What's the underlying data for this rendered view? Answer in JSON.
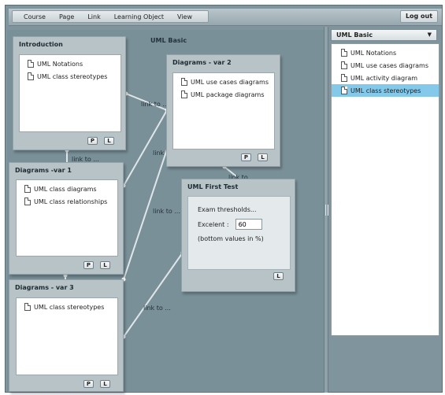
{
  "menu": {
    "items": [
      "Course",
      "Page",
      "Link",
      "Learning Object",
      "View"
    ],
    "logout": "Log out"
  },
  "canvas": {
    "title": "UML Basic",
    "link_label": "link to ...",
    "nodes": {
      "introduction": {
        "title": "Introduction",
        "items": [
          "UML Notations",
          "UML class stereotypes"
        ],
        "buttons": [
          "P",
          "L"
        ]
      },
      "diagrams_var2": {
        "title": "Diagrams - var 2",
        "items": [
          "UML use cases diagrams",
          "UML package diagrams"
        ],
        "buttons": [
          "P",
          "L"
        ]
      },
      "diagrams_var1": {
        "title": "Diagrams -var 1",
        "items": [
          "UML class diagrams",
          "UML class relationships"
        ],
        "buttons": [
          "P",
          "L"
        ]
      },
      "diagrams_var3": {
        "title": "Diagrams - var 3",
        "items": [
          "UML class stereotypes"
        ],
        "buttons": [
          "P",
          "L"
        ]
      },
      "first_test": {
        "title": "UML First Test",
        "thresholds_label": "Exam thresholds...",
        "excellent_label": "Excelent :",
        "excellent_value": "60",
        "note": "(bottom values in %)",
        "buttons": [
          "L"
        ]
      }
    }
  },
  "panel": {
    "selected": "UML Basic",
    "items": [
      "UML Notations",
      "UML use cases diagrams",
      "UML activity diagram",
      "UML class stereotypes"
    ],
    "selected_index": 3
  },
  "colors": {
    "background": "#7a9099",
    "node": "#b8c3c8",
    "highlight": "#84c9ea"
  }
}
